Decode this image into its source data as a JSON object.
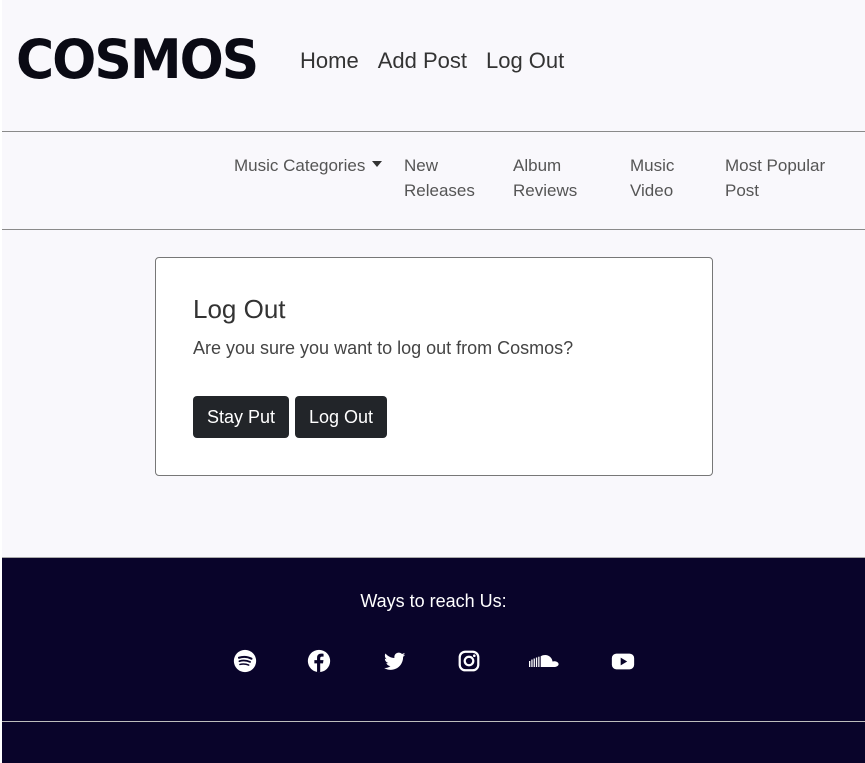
{
  "brand": {
    "logo": "COSMOS"
  },
  "top_nav": [
    "Home",
    "Add Post",
    "Log Out"
  ],
  "category_nav": {
    "dropdown_label": "Music Categories",
    "items": [
      {
        "line1": "New",
        "line2": "Releases"
      },
      {
        "line1": "Album",
        "line2": "Reviews"
      },
      {
        "line1": "Music",
        "line2": "Video"
      },
      {
        "line1": "Most Popular",
        "line2": "Post"
      }
    ]
  },
  "logout_card": {
    "title": "Log Out",
    "message": "Are you sure you want to log out from Cosmos?",
    "stay_label": "Stay Put",
    "logout_label": "Log Out"
  },
  "footer": {
    "title": "Ways to reach Us:",
    "social_icons": [
      "spotify-icon",
      "facebook-icon",
      "twitter-icon",
      "instagram-icon",
      "soundcloud-icon",
      "youtube-icon"
    ]
  },
  "colors": {
    "page_bg": "#f9f8fc",
    "footer_bg": "#09042a",
    "button_bg": "#222529"
  }
}
